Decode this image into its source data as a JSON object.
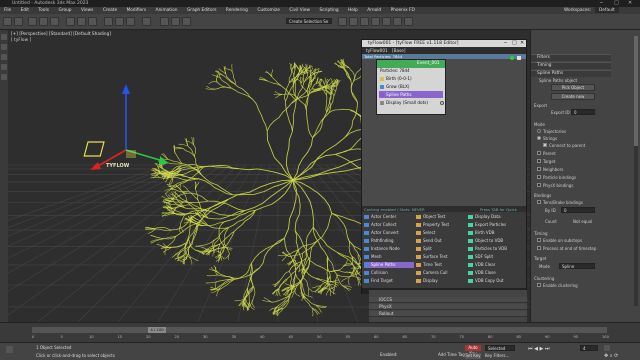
{
  "window": {
    "title": "Untitled - Autodesk 3ds Max 2023",
    "workspace_label": "Workspaces:",
    "workspace_value": "Default"
  },
  "menu": [
    "File",
    "Edit",
    "Tools",
    "Group",
    "Views",
    "Create",
    "Modifiers",
    "Animation",
    "Graph Editors",
    "Rendering",
    "Customize",
    "Civil View",
    "Scripting",
    "Help",
    "Arnold",
    "Phoenix FD"
  ],
  "toolbar": {
    "selection_set_placeholder": "Create Selection Se"
  },
  "viewport": {
    "label": "[+] [Perspective] [Standard] [Default Shading]",
    "sub_label": "[ tyFlow ]",
    "gizmo_text": "TYFLOW"
  },
  "tyflow_editor": {
    "title": "tyFlow001 - [tyFlow FREE v1.118 Editor]",
    "menu": [
      "tyFlow001",
      "[Base]"
    ],
    "total_particles": "Total Particles: 7844",
    "event_name": "Event_001",
    "event_particles": "Particles: 7844",
    "operators": [
      {
        "label": "Birth (0-0-1)",
        "color": "#d4c04a"
      },
      {
        "label": "Grow (BLX)",
        "color": "#4a88d4"
      },
      {
        "label": "Spline Paths",
        "color": "#8a5ad4",
        "selected": true
      },
      {
        "label": "Display (Small dots)",
        "color": "#888888"
      }
    ],
    "footer_left": "Caching enabled / Stats: NEVER",
    "footer_right": "Press TAB for Quick Type",
    "op_list": [
      [
        "Actor Center",
        "Object Test",
        "Display Data"
      ],
      [
        "Actor Collect",
        "Property Test",
        "Export Particles"
      ],
      [
        "Actor Convert",
        "Select",
        "Birth VDB"
      ],
      [
        "Pathfinding",
        "Send Out",
        "Object to VDB"
      ],
      [
        "Instance Node",
        "Split",
        "Particles to VDB"
      ],
      [
        "Mesh",
        "Surface Test",
        "SDF Split"
      ],
      [
        "Spline Paths",
        "Time Test",
        "VDB Clear"
      ],
      [
        "Collision",
        "Camera Cull",
        "VDB Close"
      ],
      [
        "Find Target",
        "Display",
        "VDB Copy Out"
      ]
    ],
    "selected_op": "Spline Paths"
  },
  "stats_rows": [
    "IOCCS",
    "PhysX",
    "Rollout"
  ],
  "right_panel": {
    "sections": [
      "Filters",
      "Timing",
      "Spline Paths"
    ],
    "spline_paths_object": "Spline Paths object",
    "pick_object": "Pick Object",
    "create_new": "Create new",
    "export_label": "Export",
    "export_id_label": "Export ID:",
    "export_id_value": "0",
    "mode_label": "Mode",
    "mode_options": [
      "Trajectories",
      "Strings"
    ],
    "connect_to_parent": "Connect to parent",
    "checks": [
      "Parent",
      "Target",
      "Neighbors",
      "Particle bindings",
      "PhysX bindings"
    ],
    "bindings_label": "Bindings",
    "tension_bindings": "Tens/Brake bindings",
    "by_id_label": "By ID",
    "by_id_value": "0",
    "count_label": "Count",
    "not_equal_label": "Not equal",
    "timing_label": "Timing",
    "enable_substeps": "Enable on substeps",
    "process_end": "Process at end of timestep",
    "target_label": "Target",
    "mode2_label": "Mode",
    "mode2_value": "Spline",
    "clustering_label": "Clustering",
    "enable_clustering": "Enable clustering"
  },
  "timeline": {
    "frame_display": "4 / 100",
    "ticks": [
      "0",
      "5",
      "10",
      "15",
      "20",
      "25",
      "30",
      "35",
      "40",
      "45",
      "50",
      "55",
      "60",
      "65",
      "70",
      "75",
      "80",
      "85",
      "90",
      "95",
      "100"
    ]
  },
  "status": {
    "selected": "1 Object Selected",
    "hint": "Click or click-and-drag to select objects",
    "enabled_label": "Enabled:",
    "add_time_tag": "Add Time Tag",
    "auto_key": "Auto Key",
    "selected_label": "Selected",
    "set_key": "Set Key",
    "key_filters": "Key Filters...",
    "frame_value": "4"
  },
  "colors": {
    "accent_green": "#44aa55",
    "spline_yellow": "#cfd94a",
    "selection_purple": "#8866cc",
    "gizmo_blue": "#2255ee",
    "gizmo_red": "#dd2222",
    "gizmo_green": "#22cc44"
  }
}
